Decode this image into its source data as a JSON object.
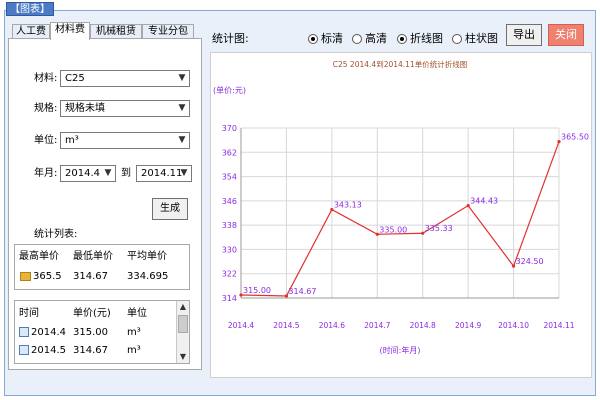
{
  "window": {
    "title": "【图表】"
  },
  "tabs": [
    {
      "label": "人工费",
      "active": false
    },
    {
      "label": "材料费",
      "active": true
    },
    {
      "label": "机械租赁",
      "active": false
    },
    {
      "label": "专业分包",
      "active": false
    }
  ],
  "form": {
    "material_label": "材料:",
    "material_value": "C25",
    "spec_label": "规格:",
    "spec_value": "规格未填",
    "unit_label": "单位:",
    "unit_value": "m³",
    "month_label": "年月:",
    "month_from": "2014.4",
    "month_to_label": "到",
    "month_to": "2014.11",
    "generate_label": "生成"
  },
  "summary": {
    "section_label": "统计列表:",
    "headers": [
      "最高单价",
      "最低单价",
      "平均单价"
    ],
    "values": [
      "365.5",
      "314.67",
      "334.695"
    ]
  },
  "list": {
    "headers": [
      "时间",
      "单价(元)",
      "单位"
    ],
    "rows": [
      {
        "time": "2014.4",
        "price": "315.00",
        "unit": "m³"
      },
      {
        "time": "2014.5",
        "price": "314.67",
        "unit": "m³"
      }
    ]
  },
  "toolbar": {
    "chart_label": "统计图:",
    "radio_standard": "标清",
    "radio_hd": "高清",
    "radio_line": "折线图",
    "radio_bar": "柱状图",
    "export_label": "导出",
    "close_label": "关闭"
  },
  "colors": {
    "accent_close": "#f08070",
    "series_line": "#e03030",
    "label_purple": "#8a2be2",
    "title_brown": "#a0522d"
  },
  "chart_data": {
    "type": "line",
    "title": "C25 2014.4到2014.11单价统计折线图",
    "ylabel": "(单价:元)",
    "xlabel": "(时间:年月)",
    "categories": [
      "2014.4",
      "2014.5",
      "2014.6",
      "2014.7",
      "2014.8",
      "2014.9",
      "2014.10",
      "2014.11"
    ],
    "series": [
      {
        "values": [
          315.0,
          314.67,
          343.13,
          335.0,
          335.33,
          344.43,
          324.5,
          365.5
        ]
      }
    ],
    "data_labels": [
      "315.00",
      "314.67",
      "343.13",
      "335.00",
      "335.33",
      "344.43",
      "324.50",
      "365.50"
    ],
    "ylim": [
      314,
      370
    ],
    "yticks": [
      314,
      322,
      330,
      338,
      346,
      354,
      362,
      370
    ],
    "grid": true,
    "legend": "none"
  }
}
